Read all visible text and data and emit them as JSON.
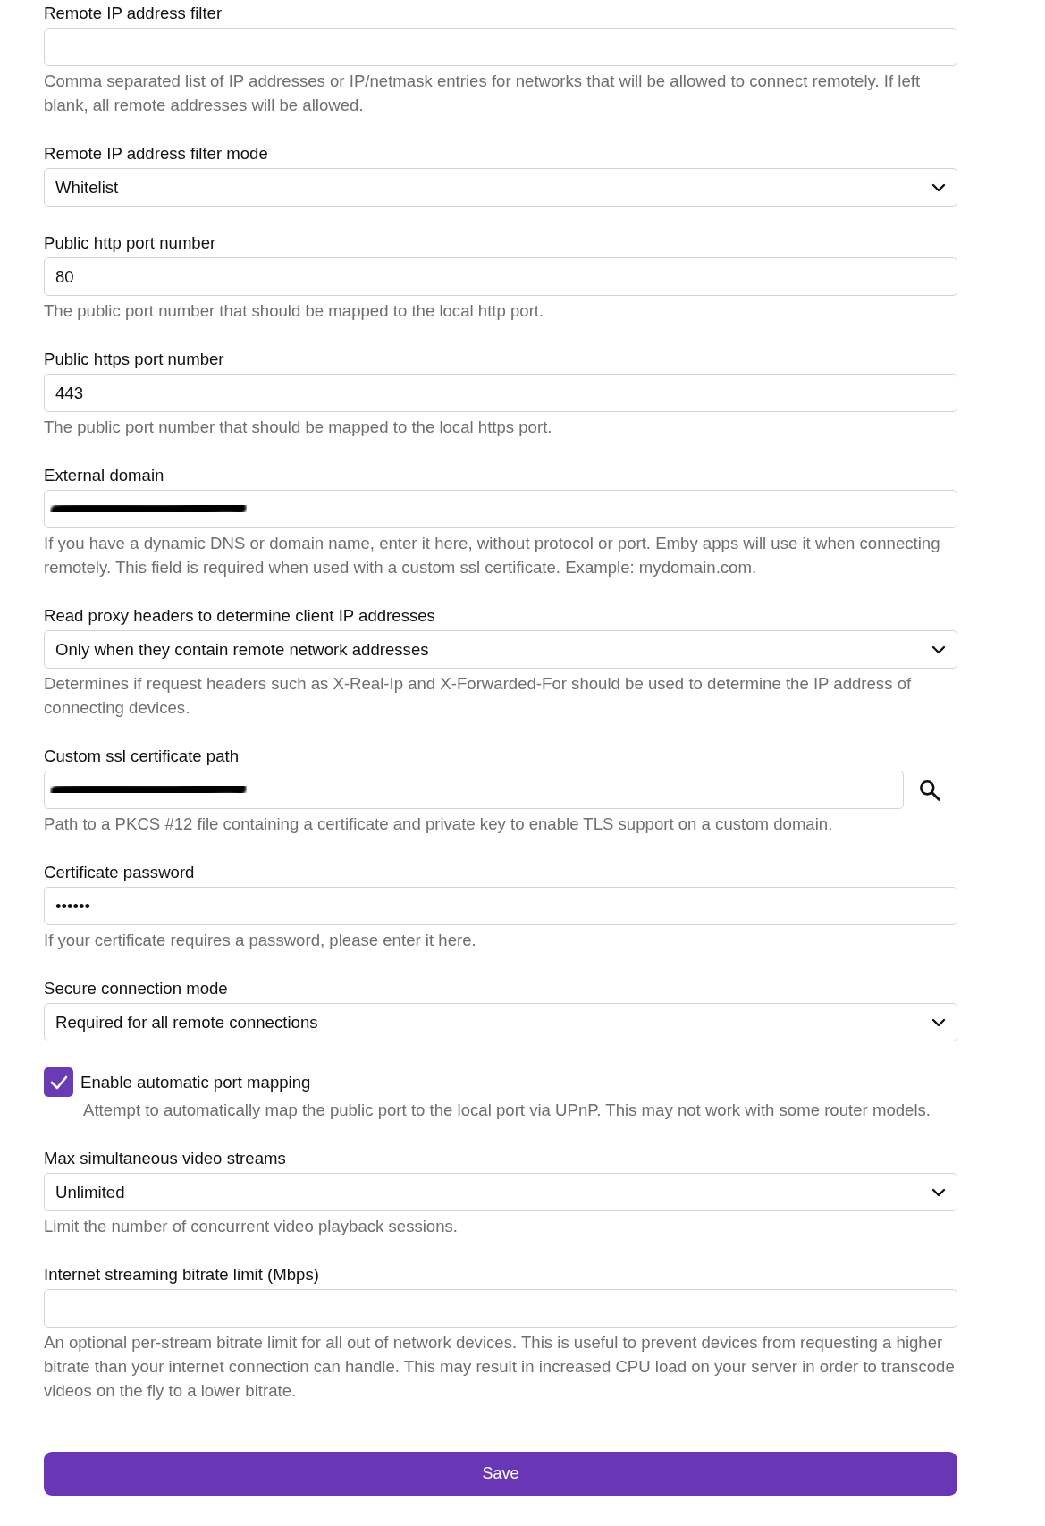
{
  "fields": [
    {
      "kind": "text",
      "label": "Remote IP address filter",
      "description": "Comma separated list of IP addresses or IP/netmask entries for networks that will be allowed to connect remotely. If left blank, all remote addresses will be allowed."
    },
    {
      "kind": "select",
      "label": "Remote IP address filter mode",
      "value": "Whitelist"
    },
    {
      "kind": "text",
      "label": "Public http port number",
      "value": "80",
      "description": "The public port number that should be mapped to the local http port."
    },
    {
      "kind": "text",
      "label": "Public https port number",
      "value": "443",
      "description": "The public port number that should be mapped to the local https port."
    },
    {
      "kind": "text",
      "label": "External domain",
      "redacted": true,
      "description": "If you have a dynamic DNS or domain name, enter it here, without protocol or port. Emby apps will use it when connecting remotely. This field is required when used with a custom ssl certificate. Example: mydomain.com."
    },
    {
      "kind": "select",
      "label": "Read proxy headers to determine client IP addresses",
      "value": "Only when they contain remote network addresses",
      "description": "Determines if request headers such as X-Real-Ip and X-Forwarded-For should be used to determine the IP address of connecting devices."
    },
    {
      "kind": "path",
      "label": "Custom ssl certificate path",
      "redacted": true,
      "description": "Path to a PKCS #12 file containing a certificate and private key to enable TLS support on a custom domain."
    },
    {
      "kind": "text",
      "label": "Certificate password",
      "value": "••••••",
      "description": "If your certificate requires a password, please enter it here."
    },
    {
      "kind": "select",
      "label": "Secure connection mode",
      "value": "Required for all remote connections"
    },
    {
      "kind": "checkbox",
      "label": "Enable automatic port mapping",
      "checked": true,
      "description": "Attempt to automatically map the public port to the local port via UPnP. This may not work with some router models."
    },
    {
      "kind": "select",
      "label": "Max simultaneous video streams",
      "value": "Unlimited",
      "description": "Limit the number of concurrent video playback sessions."
    },
    {
      "kind": "text",
      "label": "Internet streaming bitrate limit (Mbps)",
      "description": "An optional per-stream bitrate limit for all out of network devices. This is useful to prevent devices from requesting a higher bitrate than your internet connection can handle. This may result in increased CPU load on your server in order to transcode videos on the fly to a lower bitrate."
    }
  ],
  "save_button": {
    "label": "Save"
  }
}
